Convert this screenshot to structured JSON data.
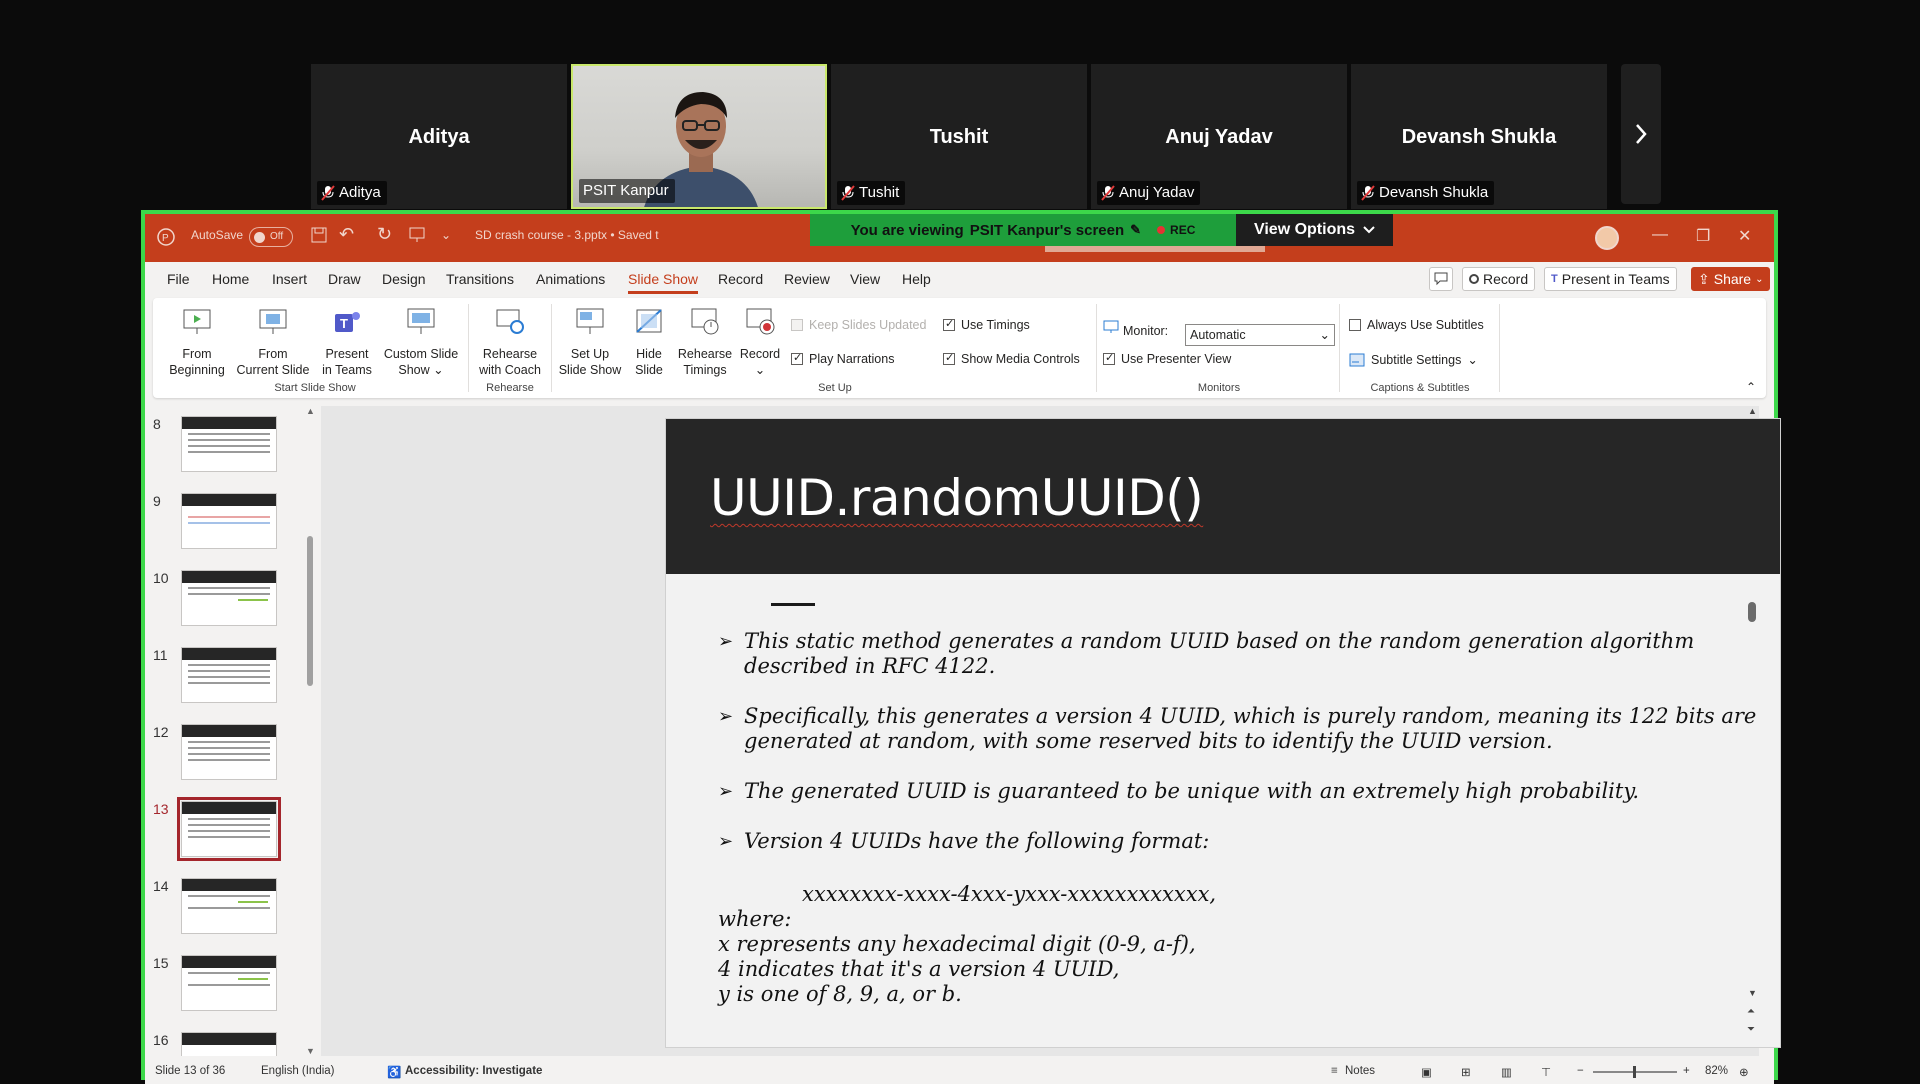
{
  "participants": [
    {
      "name": "Aditya",
      "label": "Aditya"
    },
    {
      "name": "",
      "label": "PSIT Kanpur"
    },
    {
      "name": "Tushit",
      "label": "Tushit"
    },
    {
      "name": "Anuj Yadav",
      "label": "Anuj Yadav"
    },
    {
      "name": "Devansh Shukla",
      "label": "Devansh Shukla"
    }
  ],
  "banner": {
    "viewing_prefix": "You are viewing",
    "viewing_name": "PSIT Kanpur's screen",
    "rec": "REC",
    "view_options": "View Options"
  },
  "titlebar": {
    "autosave": "AutoSave",
    "autosave_state": "Off",
    "filename": "SD crash course - 3.pptx • Saved t"
  },
  "menu": [
    "File",
    "Home",
    "Insert",
    "Draw",
    "Design",
    "Transitions",
    "Animations",
    "Slide Show",
    "Record",
    "Review",
    "View",
    "Help"
  ],
  "active_menu": "Slide Show",
  "top_buttons": {
    "record": "Record",
    "present_in_teams": "Present in Teams",
    "share": "Share"
  },
  "ribbon": {
    "from_beginning": [
      "From",
      "Beginning"
    ],
    "from_current": [
      "From",
      "Current Slide"
    ],
    "present_teams": [
      "Present",
      "in Teams"
    ],
    "custom_show": [
      "Custom Slide",
      "Show"
    ],
    "rehearse_coach": [
      "Rehearse",
      "with Coach"
    ],
    "set_up_show": [
      "Set Up",
      "Slide Show"
    ],
    "hide_slide": [
      "Hide",
      "Slide"
    ],
    "rehearse_timings": [
      "Rehearse",
      "Timings"
    ],
    "record": "Record",
    "keep_slides_updated": "Keep Slides Updated",
    "play_narrations": "Play Narrations",
    "use_timings": "Use Timings",
    "show_media_controls": "Show Media Controls",
    "monitor_label": "Monitor:",
    "monitor_value": "Automatic",
    "use_presenter_view": "Use Presenter View",
    "always_use_subtitles": "Always Use Subtitles",
    "subtitle_settings": "Subtitle Settings",
    "groups": {
      "start": "Start Slide Show",
      "rehearse": "Rehearse",
      "setup": "Set Up",
      "monitors": "Monitors",
      "captions": "Captions & Subtitles"
    }
  },
  "thumbnails": [
    "8",
    "9",
    "10",
    "11",
    "12",
    "13",
    "14",
    "15",
    "16"
  ],
  "selected_thumbnail": "13",
  "slide": {
    "title": "UUID.randomUUID()",
    "bullets": [
      "This static method generates a random UUID based on the random generation algorithm described in RFC 4122.",
      "Specifically, this generates a version 4 UUID, which is purely random, meaning its 122 bits are generated at random, with some reserved bits to identify the UUID version.",
      "The generated UUID is guaranteed to be unique with an extremely high probability.",
      "Version 4 UUIDs have the following format:"
    ],
    "format": "xxxxxxxx-xxxx-4xxx-yxxx-xxxxxxxxxxxx,",
    "where_lines": [
      "where:",
      "x represents any hexadecimal digit (0-9, a-f),",
      "4 indicates that it's a version 4 UUID,",
      "y is one of 8, 9, a, or b."
    ]
  },
  "status": {
    "slide_counter": "Slide 13 of 36",
    "language": "English (India)",
    "accessibility": "Accessibility: Investigate",
    "notes": "Notes",
    "zoom": "82%"
  },
  "colors": {
    "brand": "#c43e1c",
    "share_border": "#3cd84a",
    "banner": "#1e9e3b"
  }
}
